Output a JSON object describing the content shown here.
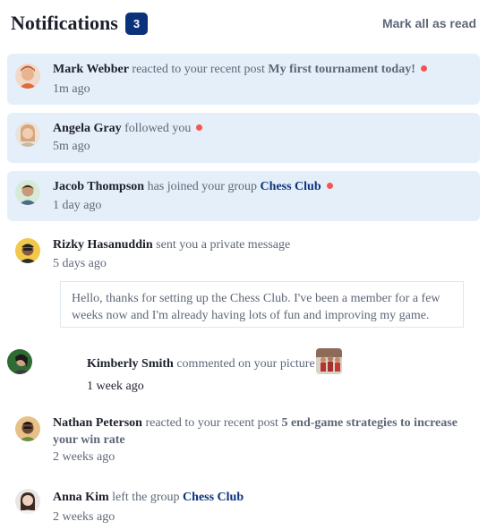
{
  "header": {
    "title": "Notifications",
    "unread_count": "3",
    "mark_all_label": "Mark all as read"
  },
  "notifications": [
    {
      "name": "Mark Webber",
      "action": "reacted to your recent post",
      "target": "My first tournament today!",
      "time": "1m ago",
      "unread": true,
      "avatar": "avatar-mark-webber"
    },
    {
      "name": "Angela Gray",
      "action": "followed you",
      "target": "",
      "time": "5m ago",
      "unread": true,
      "avatar": "avatar-angela-gray"
    },
    {
      "name": "Jacob Thompson",
      "action": "has joined your group",
      "target": "Chess Club",
      "time": "1 day ago",
      "unread": true,
      "avatar": "avatar-jacob-thompson"
    },
    {
      "name": "Rizky Hasanuddin",
      "action": "sent you a private message",
      "target": "",
      "time": "5 days ago",
      "unread": false,
      "avatar": "avatar-rizky-hasanuddin",
      "message": "Hello, thanks for setting up the Chess Club. I've been a member for a few weeks now and I'm already having lots of fun and improving my game."
    },
    {
      "name": "Kimberly Smith",
      "action": "commented on your picture",
      "target": "",
      "time": "1 week ago",
      "unread": false,
      "avatar": "avatar-kimberly-smith"
    },
    {
      "name": "Nathan Peterson",
      "action": "reacted to your recent post",
      "target": "5 end-game strategies to increase your win rate",
      "time": "2 weeks ago",
      "unread": false,
      "avatar": "avatar-nathan-peterson"
    },
    {
      "name": "Anna Kim",
      "action": "left the group",
      "target": "Chess Club",
      "time": "2 weeks ago",
      "unread": false,
      "avatar": "avatar-anna-kim"
    }
  ],
  "colors": {
    "unread_bg": "#e5effa",
    "badge": "#0a327b",
    "dot": "#f65552",
    "group_link": "#0a327b"
  }
}
